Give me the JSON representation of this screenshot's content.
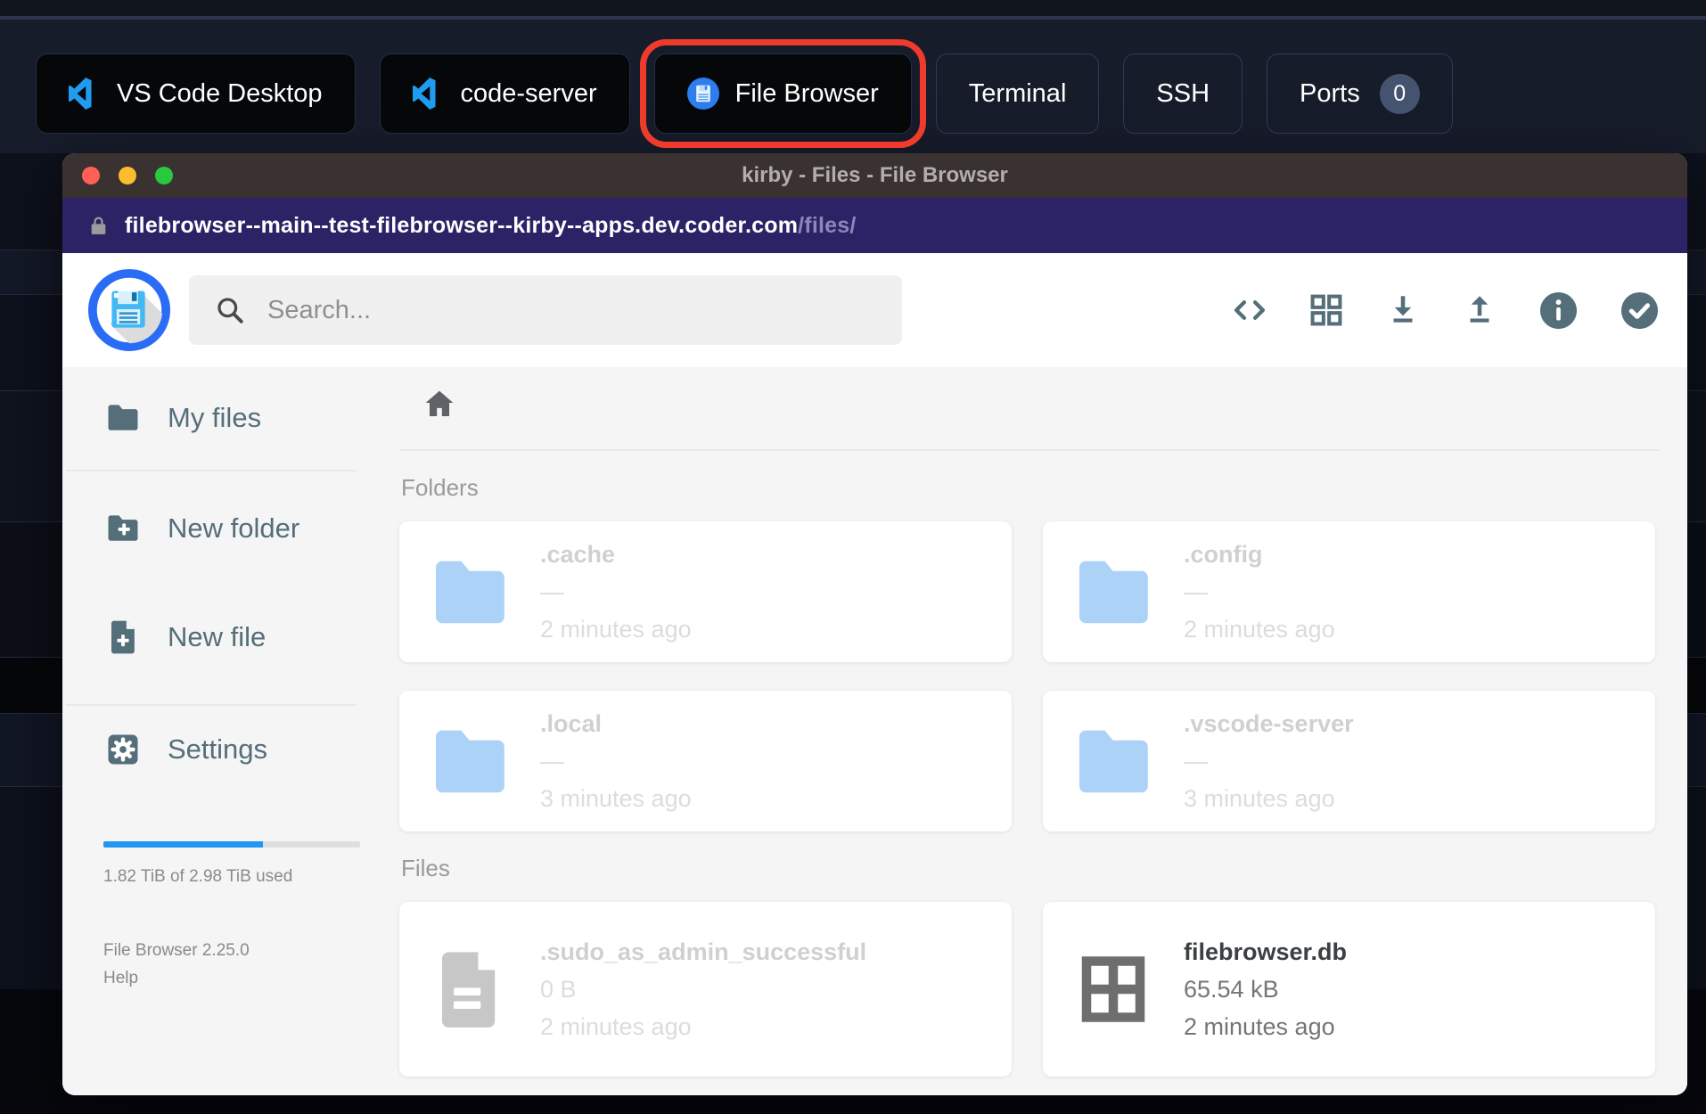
{
  "colors": {
    "accent-blue": "#2196f3",
    "brand-blue": "#2a6cf5",
    "highlight-red": "#ee3b2c",
    "icon-slate": "#546e7a",
    "folder-blue": "#5ba7f0",
    "urlbar-bg": "#2c2367",
    "titlebar-bg": "#393230",
    "topbar-button-bg": "#050709",
    "border-navy": "#2e3a55",
    "traffic-red": "#ff5f57",
    "traffic-yellow": "#febc2e",
    "traffic-green": "#28c840"
  },
  "topbar": {
    "buttons": [
      {
        "label": "VS Code Desktop",
        "icon": "vscode",
        "style": "solid",
        "highlighted": false
      },
      {
        "label": "code-server",
        "icon": "vscode",
        "style": "solid",
        "highlighted": false
      },
      {
        "label": "File Browser",
        "icon": "filebrowser",
        "style": "solid",
        "highlighted": true
      },
      {
        "label": "Terminal",
        "icon": null,
        "style": "outline",
        "highlighted": false
      },
      {
        "label": "SSH",
        "icon": null,
        "style": "outline",
        "highlighted": false
      },
      {
        "label": "Ports",
        "icon": null,
        "style": "outline",
        "highlighted": false,
        "badge": "0"
      }
    ]
  },
  "window": {
    "title": "kirby - Files - File Browser",
    "traffic_lights": [
      "close",
      "minimize",
      "maximize"
    ],
    "url": {
      "lock_icon": "lock-icon",
      "host": "filebrowser--main--test-filebrowser--kirby--apps.dev.coder.com",
      "path": "/files/"
    }
  },
  "header": {
    "logo_icon": "filebrowser-logo",
    "search_placeholder": "Search...",
    "search_value": "",
    "icons": [
      "code",
      "grid",
      "download",
      "upload",
      "info",
      "check"
    ]
  },
  "sidebar": {
    "items": [
      {
        "label": "My files",
        "icon": "folder"
      },
      {
        "label": "New folder",
        "icon": "folder-plus"
      },
      {
        "label": "New file",
        "icon": "file-plus"
      },
      {
        "label": "Settings",
        "icon": "gear"
      }
    ],
    "storage": {
      "percent": 62,
      "label": "1.82 TiB of 2.98 TiB used"
    },
    "version": "File Browser 2.25.0",
    "help_label": "Help"
  },
  "main": {
    "breadcrumb_icon": "home-icon",
    "sections": [
      {
        "label": "Folders",
        "kind": "folder",
        "items": [
          {
            "name": ".cache",
            "size": "—",
            "modified": "2 minutes ago",
            "type": "folder",
            "dimmed": true
          },
          {
            "name": ".config",
            "size": "—",
            "modified": "2 minutes ago",
            "type": "folder",
            "dimmed": true
          },
          {
            "name": ".local",
            "size": "—",
            "modified": "3 minutes ago",
            "type": "folder",
            "dimmed": true
          },
          {
            "name": ".vscode-server",
            "size": "—",
            "modified": "3 minutes ago",
            "type": "folder",
            "dimmed": true
          }
        ]
      },
      {
        "label": "Files",
        "kind": "file",
        "items": [
          {
            "name": ".sudo_as_admin_successful",
            "size": "0 B",
            "modified": "2 minutes ago",
            "type": "doc",
            "dimmed": true
          },
          {
            "name": "filebrowser.db",
            "size": "65.54 kB",
            "modified": "2 minutes ago",
            "type": "db",
            "dimmed": false
          }
        ]
      }
    ]
  }
}
